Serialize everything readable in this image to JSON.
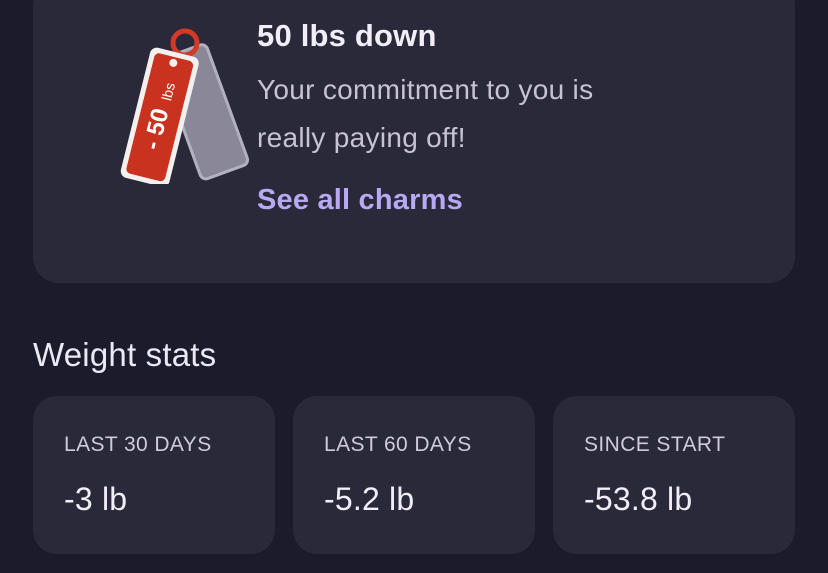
{
  "charm": {
    "tag_text_number": "- 50",
    "tag_text_unit": "lbs",
    "title": "50 lbs down",
    "description_line1": "Your commitment to you is",
    "description_line2": "really paying off!",
    "link_label": "See all charms",
    "tag_color": "#c8321f",
    "link_color": "#b7a9f2"
  },
  "weight_stats": {
    "title": "Weight stats",
    "cards": [
      {
        "label": "LAST 30 DAYS",
        "value": "-3 lb"
      },
      {
        "label": "LAST 60 DAYS",
        "value": "-5.2 lb"
      },
      {
        "label": "SINCE START",
        "value": "-53.8 lb"
      }
    ]
  }
}
